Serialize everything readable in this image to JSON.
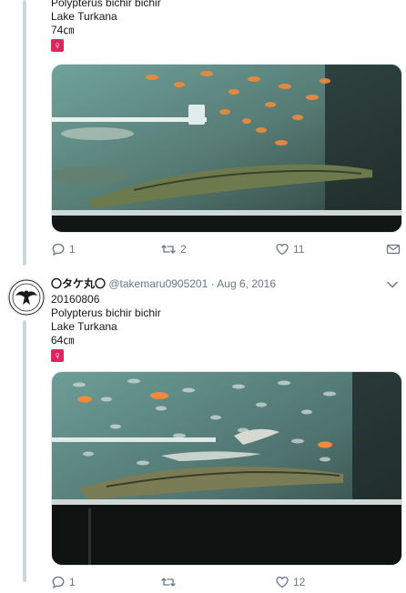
{
  "tweets": [
    {
      "lines": [
        "Polypterus bichir bichir",
        "Lake Turkana",
        "74㎝"
      ],
      "badge": "♀",
      "actions": {
        "replies": "1",
        "retweets": "2",
        "likes": "11"
      }
    },
    {
      "author": {
        "name": "〇タケ丸〇",
        "handle": "@takemaru0905201",
        "separator": "·",
        "date": "Aug 6, 2016"
      },
      "lines": [
        "20160806",
        "Polypterus bichir bichir",
        "Lake Turkana",
        "64㎝"
      ],
      "badge": "♀",
      "actions": {
        "replies": "1",
        "retweets": "",
        "likes": "12"
      }
    }
  ],
  "icons": {
    "reply": "speech-bubble-icon",
    "retweet": "retweet-arrows-icon",
    "like": "heart-icon",
    "share": "envelope-icon",
    "more": "chevron-down-icon"
  },
  "colors": {
    "text": "#14171a",
    "secondary": "#657786",
    "thread_line": "#ccd6dd",
    "female_badge": "#e0245e"
  }
}
